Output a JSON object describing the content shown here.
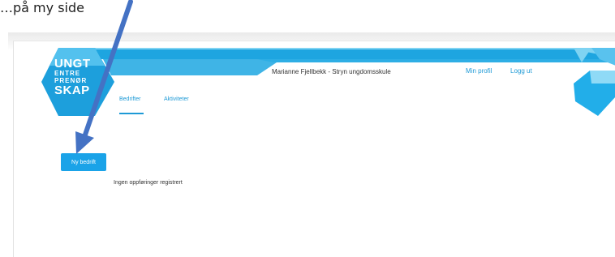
{
  "caption": "…på my side",
  "logo": {
    "line1": "UNGT",
    "line2": "ENTRE",
    "line3": "PRENØR",
    "line4": "SKAP"
  },
  "header": {
    "user": "Marianne Fjellbekk - Stryn ungdomsskule",
    "profile_link": "Min profil",
    "logout_link": "Logg ut"
  },
  "tabs": [
    {
      "label": "Bedrifter",
      "active": true
    },
    {
      "label": "Aktiviteter",
      "active": false
    }
  ],
  "main": {
    "new_button": "Ny bedrift",
    "empty_message": "Ingen oppføringer registrert"
  },
  "colors": {
    "brand_blue": "#1e9ad6",
    "header_light_blue": "#5cc6ef",
    "arrow": "#4472c4"
  }
}
